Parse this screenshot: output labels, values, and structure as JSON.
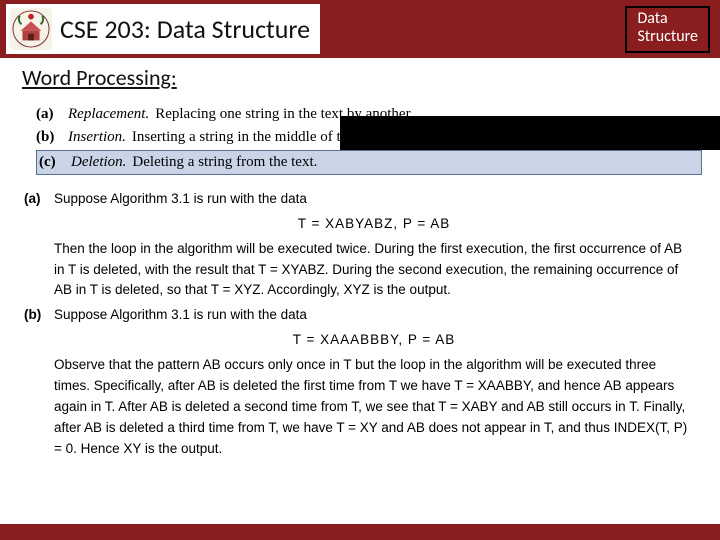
{
  "header": {
    "course_title": "CSE 203: Data Structure",
    "badge_line1": "Data",
    "badge_line2": "Structure"
  },
  "subtitle": "Word Processing:",
  "operations": [
    {
      "label": "(a)",
      "term": "Replacement.",
      "desc": "Replacing one string in the text by another."
    },
    {
      "label": "(b)",
      "term": "Insertion.",
      "desc": "Inserting a string in the middle of the text."
    },
    {
      "label": "(c)",
      "term": "Deletion.",
      "desc": "Deleting a string from the text."
    }
  ],
  "examples": {
    "a": {
      "marker": "(a)",
      "intro": "Suppose Algorithm 3.1 is run with the data",
      "eq": "T = XABYABZ,        P = AB",
      "para": "Then the loop in the algorithm will be executed twice. During the first execution, the first occurrence of AB in T is deleted, with the result that T = XYABZ. During the second execution, the remaining occurrence of AB in T is deleted, so that T = XYZ. Accordingly, XYZ is the output."
    },
    "b": {
      "marker": "(b)",
      "intro": "Suppose Algorithm 3.1 is run with the data",
      "eq": "T = XAAABBBY,        P = AB",
      "para": "Observe that the pattern AB occurs only once in T but the loop in the algorithm will be executed three times. Specifically, after AB is deleted the first time from T we have T = XAABBY, and hence AB appears again in T. After AB is deleted a second time from T, we see that T = XABY and AB still occurs in T. Finally, after AB is deleted a third time from T, we have T = XY and AB does not appear in T, and thus INDEX(T, P) = 0. Hence XY is the output."
    }
  }
}
